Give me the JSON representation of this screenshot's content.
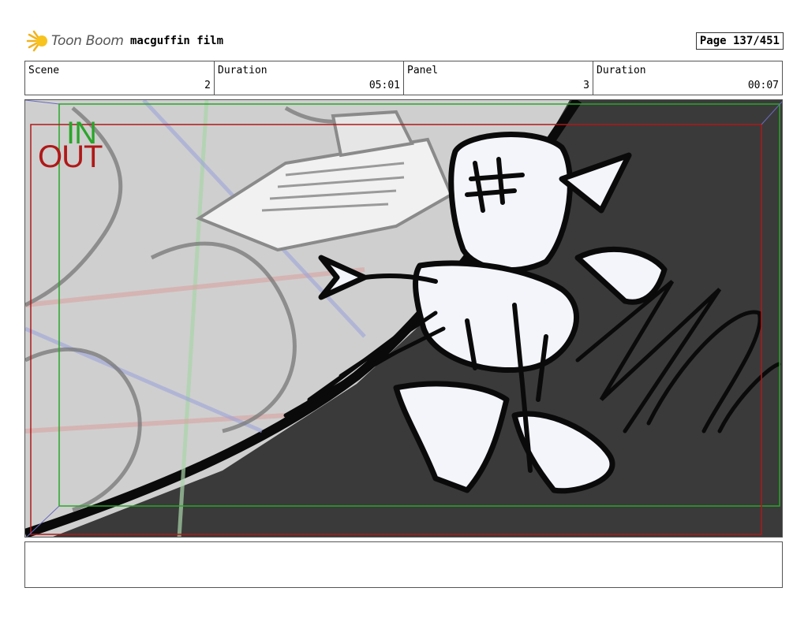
{
  "header": {
    "logo_text": "Toon Boom",
    "project_title": "macguffin film",
    "page": "Page 137/451"
  },
  "info": [
    {
      "label": "Scene",
      "value": "2"
    },
    {
      "label": "Duration",
      "value": "05:01"
    },
    {
      "label": "Panel",
      "value": "3"
    },
    {
      "label": "Duration",
      "value": "00:07"
    }
  ],
  "panel": {
    "in_label": "IN",
    "out_label": "OUT",
    "colors": {
      "in_frame": "#2aa52a",
      "out_frame": "#b01818",
      "dark_bg": "#3a3a3a",
      "light_bg": "#cfcfcf"
    }
  },
  "notes": {
    "text": ""
  }
}
